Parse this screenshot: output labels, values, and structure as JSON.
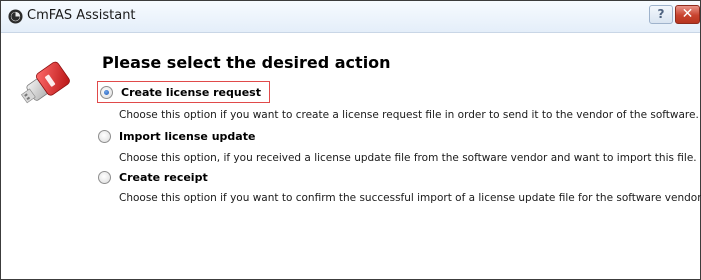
{
  "window": {
    "title": "CmFAS Assistant",
    "help_label": "?",
    "close_label": "✕"
  },
  "main": {
    "heading": "Please select the desired action",
    "options": [
      {
        "label": "Create license request",
        "description": "Choose this option if you want to create a license request file in order to send it to the vendor of the software.",
        "selected": true
      },
      {
        "label": "Import license update",
        "description": "Choose this option, if you received a license update file from the software vendor and want to import this file.",
        "selected": false
      },
      {
        "label": "Create receipt",
        "description": "Choose this option if you want to confirm the successful import of a license update file for the software vendor.",
        "selected": false
      }
    ]
  },
  "colors": {
    "selection_outline": "#e04a4a",
    "radio_dot": "#1d58b8",
    "close_button": "#c8432f"
  }
}
